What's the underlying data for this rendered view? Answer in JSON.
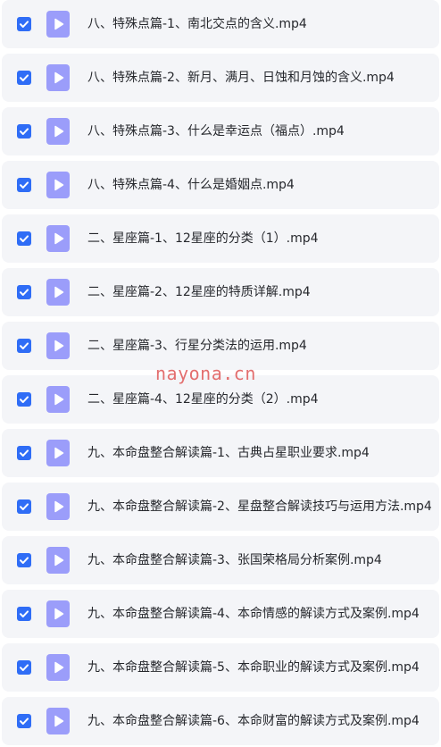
{
  "files": [
    {
      "name": "八、特殊点篇-1、南北交点的含义.mp4",
      "checked": true,
      "icon": "video-file-icon"
    },
    {
      "name": "八、特殊点篇-2、新月、满月、日蚀和月蚀的含义.mp4",
      "checked": true,
      "icon": "video-file-icon"
    },
    {
      "name": "八、特殊点篇-3、什么是幸运点（福点）.mp4",
      "checked": true,
      "icon": "video-file-icon"
    },
    {
      "name": "八、特殊点篇-4、什么是婚姻点.mp4",
      "checked": true,
      "icon": "video-file-icon"
    },
    {
      "name": "二、星座篇-1、12星座的分类（1）.mp4",
      "checked": true,
      "icon": "video-file-icon"
    },
    {
      "name": "二、星座篇-2、12星座的特质详解.mp4",
      "checked": true,
      "icon": "video-file-icon"
    },
    {
      "name": "二、星座篇-3、行星分类法的运用.mp4",
      "checked": true,
      "icon": "video-file-icon"
    },
    {
      "name": "二、星座篇-4、12星座的分类（2）.mp4",
      "checked": true,
      "icon": "video-file-icon"
    },
    {
      "name": "九、本命盘整合解读篇-1、古典占星职业要求.mp4",
      "checked": true,
      "icon": "video-file-icon"
    },
    {
      "name": "九、本命盘整合解读篇-2、星盘整合解读技巧与运用方法.mp4",
      "checked": true,
      "icon": "video-file-icon"
    },
    {
      "name": "九、本命盘整合解读篇-3、张国荣格局分析案例.mp4",
      "checked": true,
      "icon": "video-file-icon"
    },
    {
      "name": "九、本命盘整合解读篇-4、本命情感的解读方式及案例.mp4",
      "checked": true,
      "icon": "video-file-icon"
    },
    {
      "name": "九、本命盘整合解读篇-5、本命职业的解读方式及案例.mp4",
      "checked": true,
      "icon": "video-file-icon"
    },
    {
      "name": "九、本命盘整合解读篇-6、本命财富的解读方式及案例.mp4",
      "checked": true,
      "icon": "video-file-icon"
    }
  ],
  "watermark": "nayona.cn",
  "colors": {
    "checkbox": "#2f6df6",
    "file_icon": "#9b9dfa",
    "row_background": "#f4f5f8",
    "watermark": "#e36f6f"
  }
}
